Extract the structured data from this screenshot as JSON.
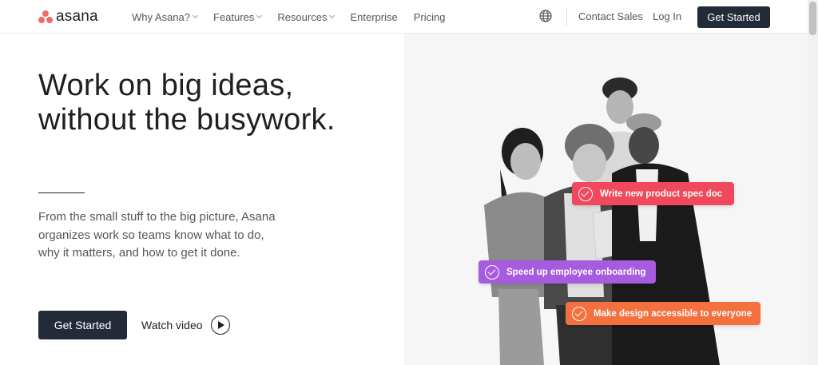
{
  "nav": {
    "brand": "asana",
    "links": [
      {
        "label": "Why Asana?",
        "dropdown": true
      },
      {
        "label": "Features",
        "dropdown": true
      },
      {
        "label": "Resources",
        "dropdown": true
      },
      {
        "label": "Enterprise",
        "dropdown": false
      },
      {
        "label": "Pricing",
        "dropdown": false
      }
    ],
    "globe_icon": "globe-icon",
    "contact_sales": "Contact Sales",
    "login": "Log In",
    "cta": "Get Started"
  },
  "hero": {
    "headline_line1": "Work on big ideas,",
    "headline_line2": "without the busywork.",
    "subtext": "From the small stuff to the big picture, Asana organizes work so teams know what to do, why it matters, and how to get it done.",
    "cta": "Get Started",
    "watch_video": "Watch video"
  },
  "tags": [
    {
      "label": "Write new product spec doc",
      "color": "#f0485c"
    },
    {
      "label": "Speed up employee onboarding",
      "color": "#a75ce0"
    },
    {
      "label": "Make design accessible to everyone",
      "color": "#f5703f"
    }
  ],
  "colors": {
    "brand": "#f06a6a",
    "button_dark": "#222b37"
  }
}
